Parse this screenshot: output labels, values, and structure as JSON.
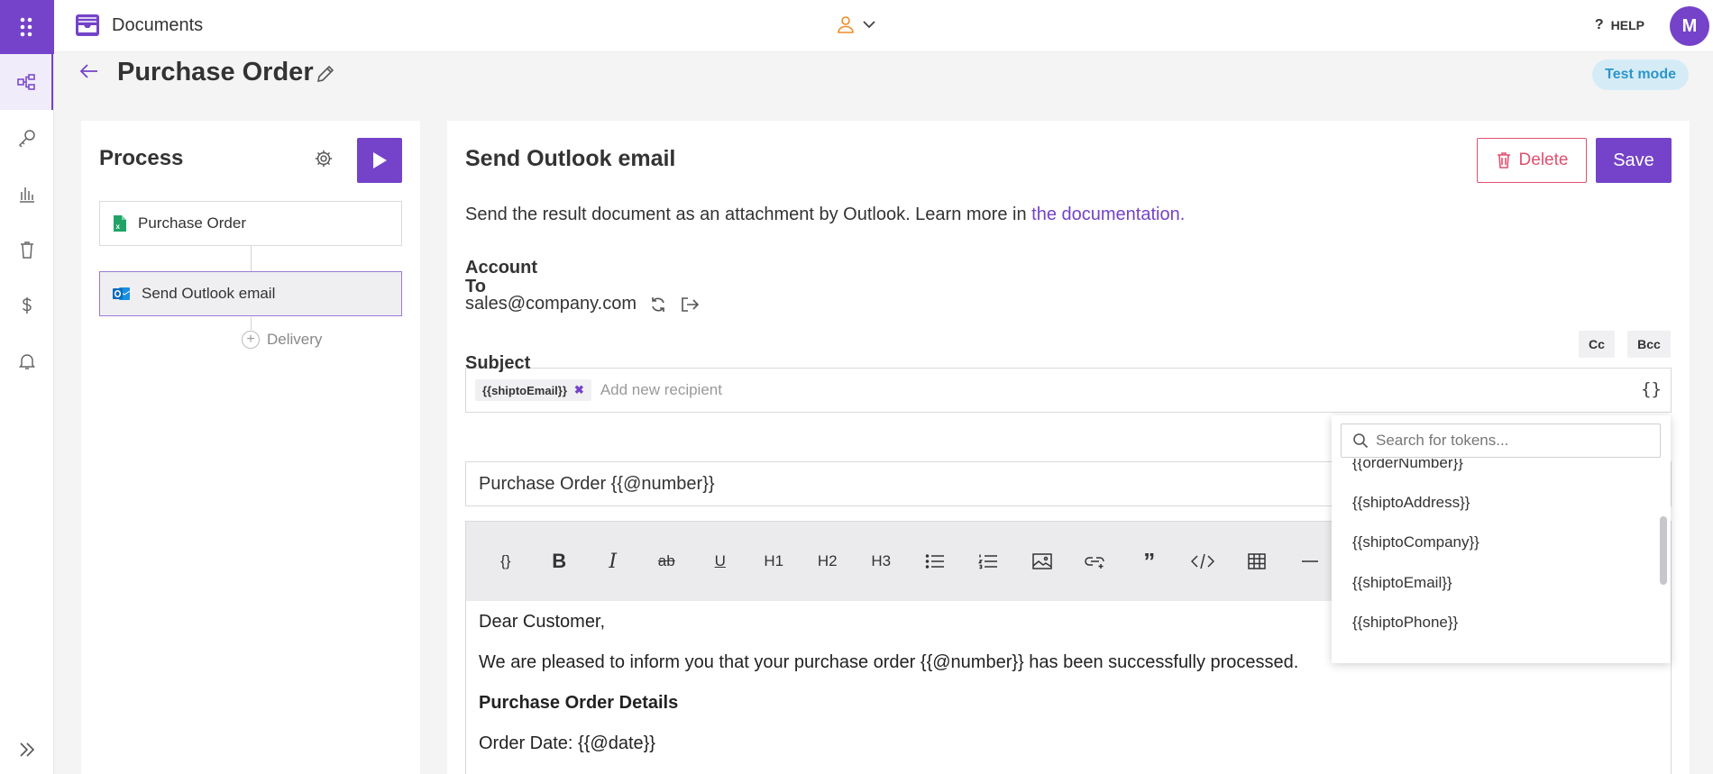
{
  "app": {
    "name": "Documents",
    "help_label": "HELP",
    "avatar_initial": "M",
    "accent_color": "#7443c9"
  },
  "rail": {
    "items": [
      {
        "icon": "workflow-icon",
        "active": true
      },
      {
        "icon": "key-icon"
      },
      {
        "icon": "bar-chart-icon"
      },
      {
        "icon": "trash-icon"
      },
      {
        "icon": "dollar-icon"
      },
      {
        "icon": "bell-icon"
      }
    ],
    "expand_icon": "double-chevron-right-icon"
  },
  "page": {
    "title": "Purchase Order",
    "test_mode_label": "Test mode"
  },
  "process": {
    "title": "Process",
    "steps": [
      {
        "label": "Purchase Order",
        "icon": "excel-file-icon"
      },
      {
        "label": "Send Outlook email",
        "icon": "outlook-icon",
        "selected": true
      }
    ],
    "delivery_label": "Delivery"
  },
  "email": {
    "title": "Send Outlook email",
    "delete_label": "Delete",
    "save_label": "Save",
    "description": "Send the result document as an attachment by Outlook. Learn more in ",
    "doc_link": "the documentation.",
    "account_label": "Account",
    "account_value": "sales@company.com",
    "to_label": "To",
    "cc_label": "Cc",
    "bcc_label": "Bcc",
    "recipient_chip": "{{shiptoEmail}}",
    "recipient_placeholder": "Add new recipient",
    "subject_label": "Subject",
    "subject_value": "Purchase Order {{@number}}",
    "toolbar": {
      "braces": "{}",
      "bold": "B",
      "italic": "I",
      "strike": "ab",
      "underline": "U",
      "h1": "H1",
      "h2": "H2",
      "h3": "H3",
      "quote": "”"
    },
    "body": [
      {
        "text": "Dear Customer,",
        "bold": false
      },
      {
        "text": "We are pleased to inform you that your purchase order {{@number}} has been successfully processed.",
        "bold": false
      },
      {
        "text": "Purchase Order Details",
        "bold": true
      },
      {
        "text": "Order Date: {{@date}}",
        "bold": false
      }
    ]
  },
  "token_dropdown": {
    "search_placeholder": "Search for tokens...",
    "tokens": [
      "{{orderNumber}}",
      "{{shiptoAddress}}",
      "{{shiptoCompany}}",
      "{{shiptoEmail}}",
      "{{shiptoPhone}}"
    ]
  }
}
